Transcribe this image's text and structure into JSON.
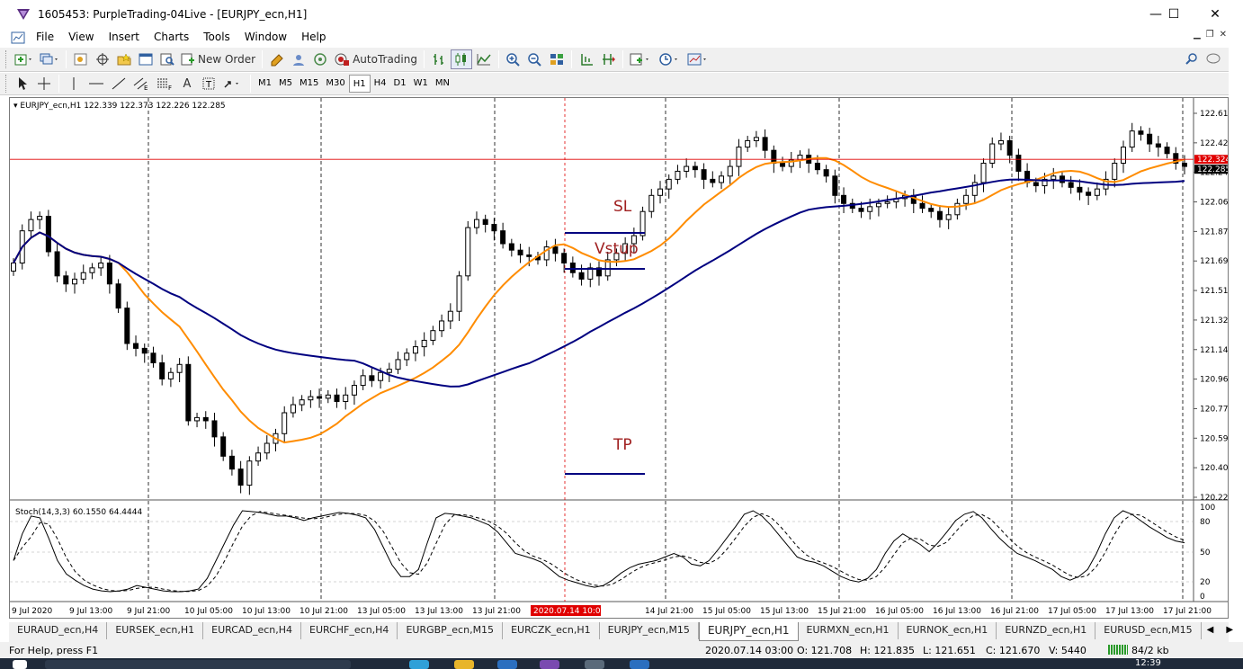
{
  "window": {
    "title": "1605453: PurpleTrading-04Live - [EURJPY_ecn,H1]",
    "minimize": "—",
    "maximize": "☐",
    "close": "✕"
  },
  "menu": [
    "File",
    "View",
    "Insert",
    "Charts",
    "Tools",
    "Window",
    "Help"
  ],
  "toolbar": {
    "new_order": "New Order",
    "autotrading": "AutoTrading",
    "timeframes": [
      "M1",
      "M5",
      "M15",
      "M30",
      "H1",
      "H4",
      "D1",
      "W1",
      "MN"
    ],
    "active_timeframe": "H1"
  },
  "chart": {
    "header": "EURJPY_ecn,H1  122.339 122.373 122.226 122.285",
    "price_labels": [
      "122.610",
      "122.425",
      "122.240",
      "122.060",
      "121.875",
      "121.690",
      "121.510",
      "121.325",
      "121.140",
      "120.960",
      "120.775",
      "120.590",
      "120.405",
      "120.225"
    ],
    "bid_line_label": "122.324",
    "last_price_label": "122.285",
    "annotations": {
      "sl": "SL",
      "vstup": "Vstup",
      "tp": "TP"
    },
    "indicator_header": "Stoch(14,3,3) 60.1550 64.4444",
    "indicator_levels": [
      "100",
      "80",
      "50",
      "20",
      "0"
    ],
    "time_labels": [
      "9 Jul 2020",
      "9 Jul 13:00",
      "9 Jul 21:00",
      "10 Jul 05:00",
      "10 Jul 13:00",
      "10 Jul 21:00",
      "13 Jul 05:00",
      "13 Jul 13:00",
      "13 Jul 21:00",
      "14 Jul 21:00",
      "15 Jul 05:00",
      "15 Jul 13:00",
      "15 Jul 21:00",
      "16 Jul 05:00",
      "16 Jul 13:00",
      "16 Jul 21:00",
      "17 Jul 05:00",
      "17 Jul 13:00",
      "17 Jul 21:00"
    ],
    "cursor_time_label": "2020.07.14 10:00",
    "colors": {
      "bullish": "#000000",
      "ma_fast": "#ff8c00",
      "ma_slow": "#000080",
      "bid_line": "#e00000",
      "levels": "#000080"
    }
  },
  "tabs": [
    "EURAUD_ecn,H4",
    "EURSEK_ecn,H1",
    "EURCAD_ecn,H4",
    "EURCHF_ecn,H4",
    "EURGBP_ecn,M15",
    "EURCZK_ecn,H1",
    "EURJPY_ecn,M15",
    "EURJPY_ecn,H1",
    "EURMXN_ecn,H1",
    "EURNOK_ecn,H1",
    "EURNZD_ecn,H1",
    "EURUSD_ecn,M15"
  ],
  "active_tab": "EURJPY_ecn,H1",
  "status": {
    "help": "For Help, press F1",
    "time": "2020.07.14 03:00",
    "open": "O: 121.708",
    "high": "H: 121.835",
    "low": "L: 121.651",
    "close": "C: 121.670",
    "volume": "V: 5440",
    "traffic": "84/2 kb"
  },
  "taskbar": {
    "clock": "12:39"
  }
}
